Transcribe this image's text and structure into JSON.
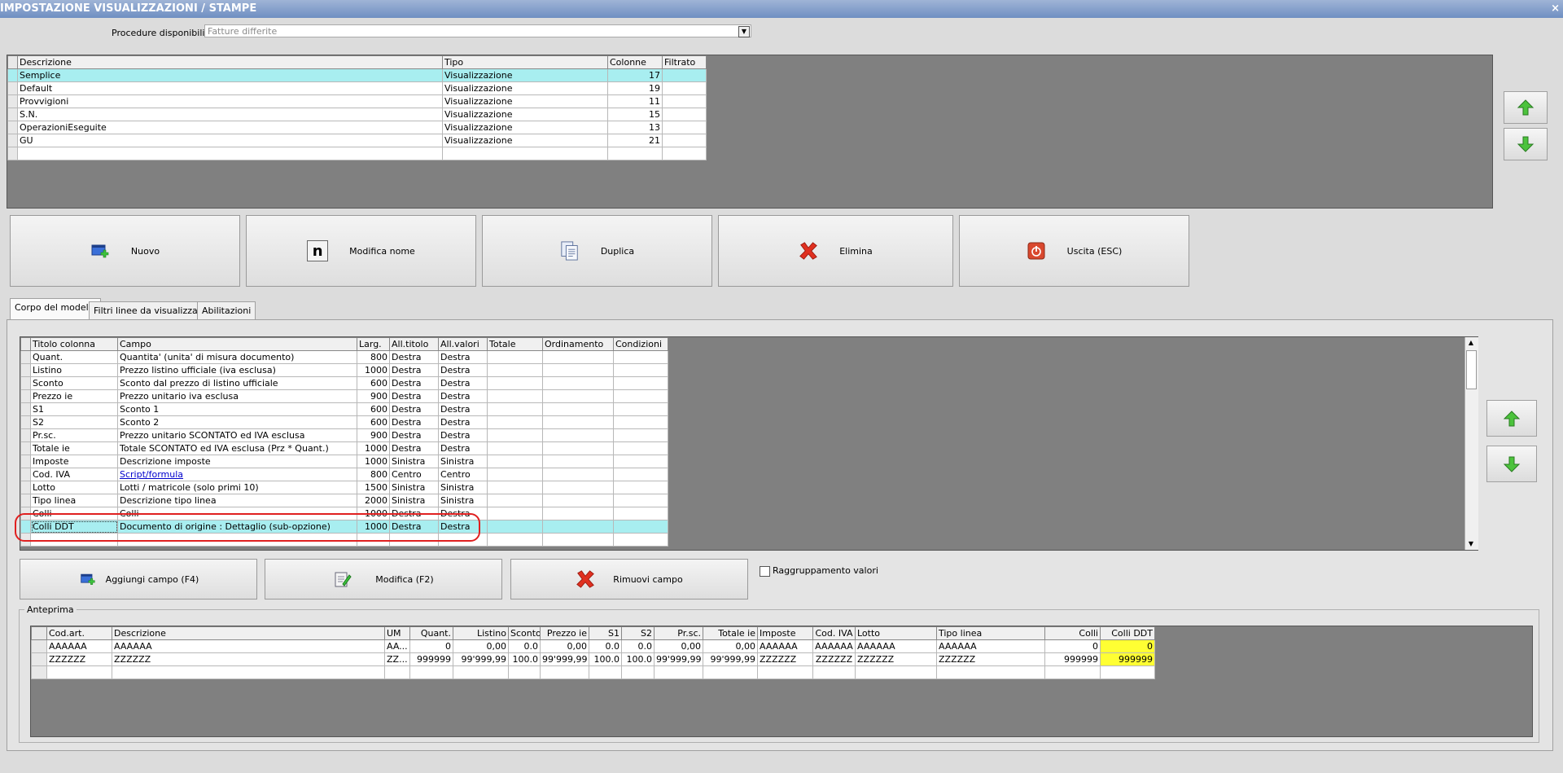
{
  "window": {
    "title": "IMPOSTAZIONE VISUALIZZAZIONI / STAMPE",
    "close": "×"
  },
  "procedure": {
    "label": "Procedure disponibili :",
    "value": "Fatture differite"
  },
  "models": {
    "headers": [
      "Descrizione",
      "Tipo",
      "Colonne",
      "Filtrato"
    ],
    "rows": [
      [
        "Semplice",
        "Visualizzazione",
        "17",
        ""
      ],
      [
        "Default",
        "Visualizzazione",
        "19",
        ""
      ],
      [
        "Provvigioni",
        "Visualizzazione",
        "11",
        ""
      ],
      [
        "S.N.",
        "Visualizzazione",
        "15",
        ""
      ],
      [
        "OperazioniEseguite",
        "Visualizzazione",
        "13",
        ""
      ],
      [
        "GU",
        "Visualizzazione",
        "21",
        ""
      ]
    ]
  },
  "actions": {
    "nuovo": "Nuovo",
    "modifica_nome": "Modifica nome",
    "duplica": "Duplica",
    "elimina": "Elimina",
    "uscita": "Uscita (ESC)"
  },
  "tabs": [
    "Corpo del modello",
    "Filtri linee da visualizzare",
    "Abilitazioni"
  ],
  "fields": {
    "headers": [
      "Titolo colonna",
      "Campo",
      "Larg.",
      "All.titolo",
      "All.valori",
      "Totale",
      "Ordinamento",
      "Condizioni"
    ],
    "rows": [
      [
        "Quant.",
        "Quantita' (unita' di misura documento)",
        "800",
        "Destra",
        "Destra",
        "",
        "",
        ""
      ],
      [
        "Listino",
        "Prezzo listino ufficiale (iva esclusa)",
        "1000",
        "Destra",
        "Destra",
        "",
        "",
        ""
      ],
      [
        "Sconto",
        "Sconto dal prezzo di listino ufficiale",
        "600",
        "Destra",
        "Destra",
        "",
        "",
        ""
      ],
      [
        "Prezzo ie",
        "Prezzo unitario iva esclusa",
        "900",
        "Destra",
        "Destra",
        "",
        "",
        ""
      ],
      [
        "S1",
        "Sconto 1",
        "600",
        "Destra",
        "Destra",
        "",
        "",
        ""
      ],
      [
        "S2",
        "Sconto 2",
        "600",
        "Destra",
        "Destra",
        "",
        "",
        ""
      ],
      [
        "Pr.sc.",
        "Prezzo unitario SCONTATO ed IVA esclusa",
        "900",
        "Destra",
        "Destra",
        "",
        "",
        ""
      ],
      [
        "Totale ie",
        "Totale SCONTATO ed IVA esclusa (Prz * Quant.)",
        "1000",
        "Destra",
        "Destra",
        "",
        "",
        ""
      ],
      [
        "Imposte",
        "Descrizione imposte",
        "1000",
        "Sinistra",
        "Sinistra",
        "",
        "",
        ""
      ],
      [
        "Cod. IVA",
        "Script/formula",
        "800",
        "Centro",
        "Centro",
        "",
        "",
        ""
      ],
      [
        "Lotto",
        "Lotti / matricole (solo primi 10)",
        "1500",
        "Sinistra",
        "Sinistra",
        "",
        "",
        ""
      ],
      [
        "Tipo linea",
        "Descrizione tipo linea",
        "2000",
        "Sinistra",
        "Sinistra",
        "",
        "",
        ""
      ],
      [
        "Colli",
        "Colli",
        "1000",
        "Destra",
        "Destra",
        "",
        "",
        ""
      ],
      [
        "Colli DDT",
        "Documento di origine : Dettaglio (sub-opzione)",
        "1000",
        "Destra",
        "Destra",
        "",
        "",
        ""
      ]
    ]
  },
  "field_actions": {
    "aggiungi": "Aggiungi campo (F4)",
    "modifica": "Modifica (F2)",
    "rimuovi": "Rimuovi campo",
    "raggruppamento": "Raggruppamento valori"
  },
  "preview": {
    "label": "Anteprima",
    "headers": [
      "Cod.art.",
      "Descrizione",
      "UM",
      "Quant.",
      "Listino",
      "Sconto",
      "Prezzo ie",
      "S1",
      "S2",
      "Pr.sc.",
      "Totale ie",
      "Imposte",
      "Cod. IVA",
      "Lotto",
      "Tipo linea",
      "Colli",
      "Colli DDT"
    ],
    "rows": [
      [
        "AAAAAA",
        "AAAAAA",
        "AA...",
        "0",
        "0,00",
        "0.0",
        "0,00",
        "0.0",
        "0.0",
        "0,00",
        "0,00",
        "AAAAAA",
        "AAAAAA",
        "AAAAAA",
        "AAAAAA",
        "0",
        "0"
      ],
      [
        "ZZZZZZ",
        "ZZZZZZ",
        "ZZ...",
        "999999",
        "99'999,99",
        "100.0",
        "99'999,99",
        "100.0",
        "100.0",
        "99'999,99",
        "99'999,99",
        "ZZZZZZ",
        "ZZZZZZ",
        "ZZZZZZ",
        "ZZZZZZ",
        "999999",
        "999999"
      ]
    ]
  },
  "colors": {
    "selection": "#a8eef0",
    "highlight_border": "#e02020",
    "preview_highlight": "#ffff33"
  }
}
